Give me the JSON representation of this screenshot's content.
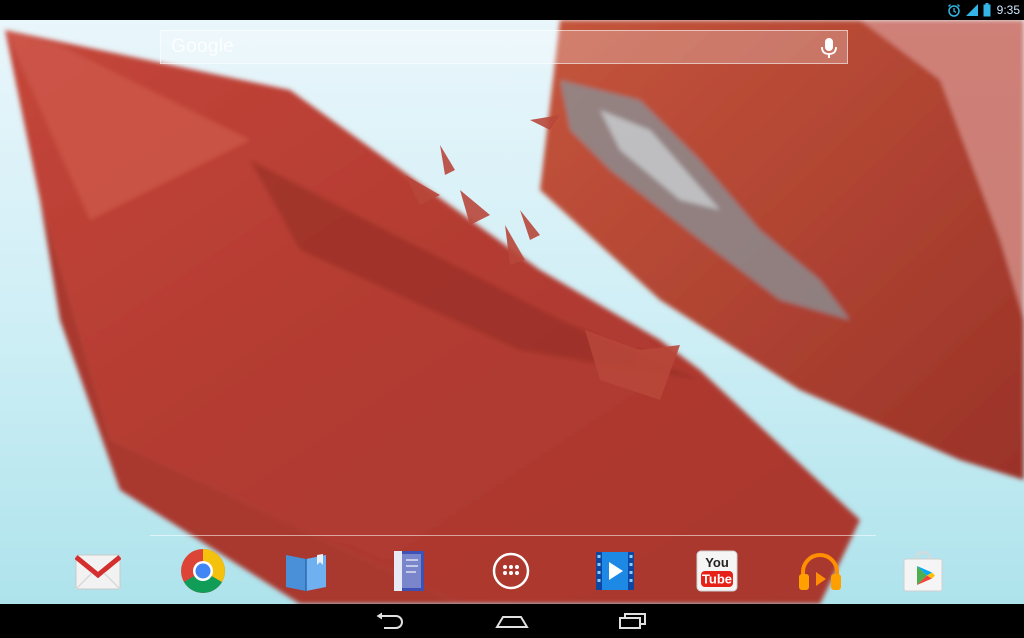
{
  "status_bar": {
    "time": "9:35",
    "icons": [
      "alarm-icon",
      "signal-icon",
      "battery-icon"
    ]
  },
  "search": {
    "logo_text": "Google",
    "voice_icon": "mic-icon"
  },
  "dock": {
    "apps": [
      {
        "name": "Gmail",
        "icon": "gmail-icon"
      },
      {
        "name": "Chrome",
        "icon": "chrome-icon"
      },
      {
        "name": "Play Books",
        "icon": "books-icon"
      },
      {
        "name": "Play Magazines",
        "icon": "magazines-icon"
      },
      {
        "name": "Apps",
        "icon": "app-drawer-icon"
      },
      {
        "name": "Play Movies",
        "icon": "movies-icon"
      },
      {
        "name": "YouTube",
        "icon": "youtube-icon",
        "label_top": "You",
        "label_bottom": "Tube"
      },
      {
        "name": "Play Music",
        "icon": "music-icon"
      },
      {
        "name": "Play Store",
        "icon": "play-store-icon"
      }
    ]
  },
  "nav": {
    "buttons": [
      "back-icon",
      "home-icon",
      "recents-icon"
    ]
  },
  "colors": {
    "sky": "#cdeef5",
    "crystal": "#b8473a",
    "status_blue": "#33b5e5"
  }
}
